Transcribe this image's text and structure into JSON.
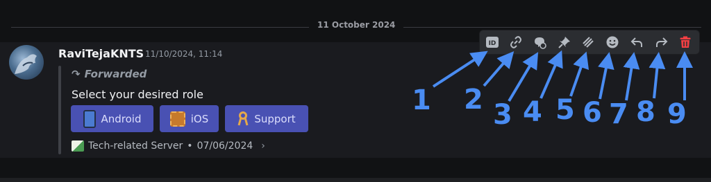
{
  "divider": {
    "date": "11 October 2024"
  },
  "message": {
    "author": "RaviTejaKNTS",
    "timestamp": "11/10/2024, 11:14",
    "forwarded_label": "Forwarded",
    "content": "Select your desired role",
    "buttons": [
      {
        "label": "Android",
        "icon": "phone-emoji"
      },
      {
        "label": "iOS",
        "icon": "chip-emoji"
      },
      {
        "label": "Support",
        "icon": "ribbon-emoji"
      }
    ],
    "source": {
      "server": "Tech-related Server",
      "separator": "•",
      "date": "07/06/2024"
    }
  },
  "toolbar": {
    "icons": [
      "id-icon",
      "link-icon",
      "thread-icon",
      "pin-icon",
      "apps-icon",
      "emoji-icon",
      "reply-icon",
      "forward-icon",
      "trash-icon"
    ]
  },
  "annotations": {
    "numbers": [
      "1",
      "2",
      "3",
      "4",
      "5",
      "6",
      "7",
      "8",
      "9"
    ],
    "color": "#4a8cf2"
  },
  "colors": {
    "accent_button": "#4951b3",
    "delete": "#f23f43"
  }
}
